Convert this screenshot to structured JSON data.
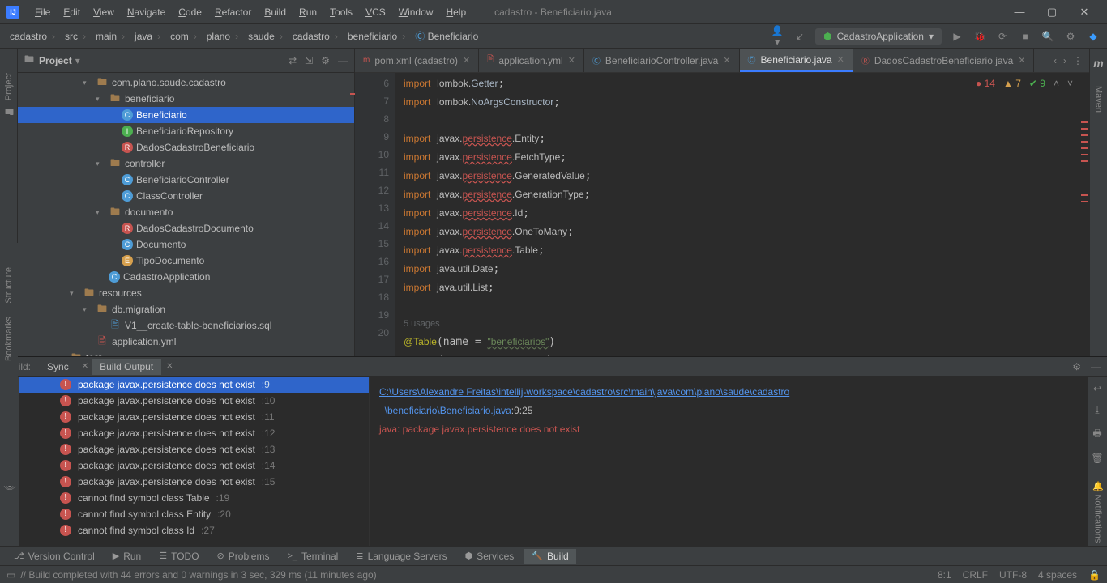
{
  "window": {
    "title": "cadastro - Beneficiario.java"
  },
  "menu": [
    "File",
    "Edit",
    "View",
    "Navigate",
    "Code",
    "Refactor",
    "Build",
    "Run",
    "Tools",
    "VCS",
    "Window",
    "Help"
  ],
  "breadcrumb": [
    "cadastro",
    "src",
    "main",
    "java",
    "com",
    "plano",
    "saude",
    "cadastro",
    "beneficiario",
    "Beneficiario"
  ],
  "runconfig": "CadastroApplication",
  "sidebar": {
    "title": "Project"
  },
  "tree": [
    {
      "d": 5,
      "a": "▾",
      "i": "pkg",
      "t": "com.plano.saude.cadastro"
    },
    {
      "d": 6,
      "a": "▾",
      "i": "pkg",
      "t": "beneficiario"
    },
    {
      "d": 7,
      "a": " ",
      "i": "cls",
      "ic": "C",
      "t": "Beneficiario",
      "sel": true
    },
    {
      "d": 7,
      "a": " ",
      "i": "int",
      "ic": "I",
      "t": "BeneficiarioRepository"
    },
    {
      "d": 7,
      "a": " ",
      "i": "rec",
      "ic": "R",
      "t": "DadosCadastroBeneficiario"
    },
    {
      "d": 6,
      "a": "▾",
      "i": "pkg",
      "t": "controller"
    },
    {
      "d": 7,
      "a": " ",
      "i": "cls",
      "ic": "C",
      "t": "BeneficiarioController"
    },
    {
      "d": 7,
      "a": " ",
      "i": "cls",
      "ic": "C",
      "t": "ClassController"
    },
    {
      "d": 6,
      "a": "▾",
      "i": "pkg",
      "t": "documento"
    },
    {
      "d": 7,
      "a": " ",
      "i": "rec",
      "ic": "R",
      "t": "DadosCadastroDocumento"
    },
    {
      "d": 7,
      "a": " ",
      "i": "cls",
      "ic": "C",
      "t": "Documento"
    },
    {
      "d": 7,
      "a": " ",
      "i": "enu",
      "ic": "E",
      "t": "TipoDocumento"
    },
    {
      "d": 6,
      "a": " ",
      "i": "cls",
      "ic": "C",
      "t": "CadastroApplication"
    },
    {
      "d": 4,
      "a": "▾",
      "i": "dir",
      "ic": "🖿",
      "t": "resources"
    },
    {
      "d": 5,
      "a": "▾",
      "i": "dir",
      "ic": "🖿",
      "t": "db.migration"
    },
    {
      "d": 6,
      "a": " ",
      "i": "sql",
      "ic": "🖹",
      "t": "V1__create-table-beneficiarios.sql"
    },
    {
      "d": 5,
      "a": " ",
      "i": "yml",
      "ic": "🖹",
      "t": "application.yml"
    },
    {
      "d": 3,
      "a": "▾",
      "i": "dir",
      "ic": "🖿",
      "t": "test"
    }
  ],
  "tabs": [
    {
      "n": "pom.xml (cadastro)",
      "i": "m",
      "c": "#c75450"
    },
    {
      "n": "application.yml",
      "i": "🖹",
      "c": "#c75450"
    },
    {
      "n": "BeneficiarioController.java",
      "i": "Ⓒ",
      "c": "#4e9cd6"
    },
    {
      "n": "Beneficiario.java",
      "i": "Ⓒ",
      "c": "#4e9cd6",
      "act": true
    },
    {
      "n": "DadosCadastroBeneficiario.java",
      "i": "Ⓡ",
      "c": "#c75450"
    }
  ],
  "lineNos": [
    6,
    7,
    8,
    9,
    10,
    11,
    12,
    13,
    14,
    15,
    16,
    17,
    18,
    "",
    "",
    19,
    20
  ],
  "indicators": {
    "err": "14",
    "warn": "7",
    "ok": "9"
  },
  "usages": "5 usages",
  "table": "beneficiarios",
  "entity": "Beneficiario",
  "build": {
    "label": "Build:",
    "tabs": [
      "Sync",
      "Build Output"
    ],
    "errs": [
      {
        "m": "package javax.persistence does not exist",
        "l": ":9",
        "sel": true
      },
      {
        "m": "package javax.persistence does not exist",
        "l": ":10"
      },
      {
        "m": "package javax.persistence does not exist",
        "l": ":11"
      },
      {
        "m": "package javax.persistence does not exist",
        "l": ":12"
      },
      {
        "m": "package javax.persistence does not exist",
        "l": ":13"
      },
      {
        "m": "package javax.persistence does not exist",
        "l": ":14"
      },
      {
        "m": "package javax.persistence does not exist",
        "l": ":15"
      },
      {
        "m": "cannot find symbol class Table",
        "l": ":19"
      },
      {
        "m": "cannot find symbol class Entity",
        "l": ":20"
      },
      {
        "m": "cannot find symbol class Id",
        "l": ":27"
      }
    ],
    "out_path1": "C:\\Users\\Alexandre Freitas\\intellij-workspace\\cadastro\\src\\main\\java\\com\\plano\\saude\\cadastro",
    "out_path2": "\\beneficiario\\Beneficiario.java",
    "out_loc": ":9:25",
    "out_err": "java: package javax.persistence does not exist"
  },
  "bottombar": [
    "Version Control",
    "Run",
    "TODO",
    "Problems",
    "Terminal",
    "Language Servers",
    "Services",
    "Build"
  ],
  "status": {
    "msg": "// Build completed with 44 errors and 0 warnings in 3 sec, 329 ms (11 minutes ago)",
    "pos": "8:1",
    "eol": "CRLF",
    "enc": "UTF-8",
    "ind": "4 spaces"
  }
}
